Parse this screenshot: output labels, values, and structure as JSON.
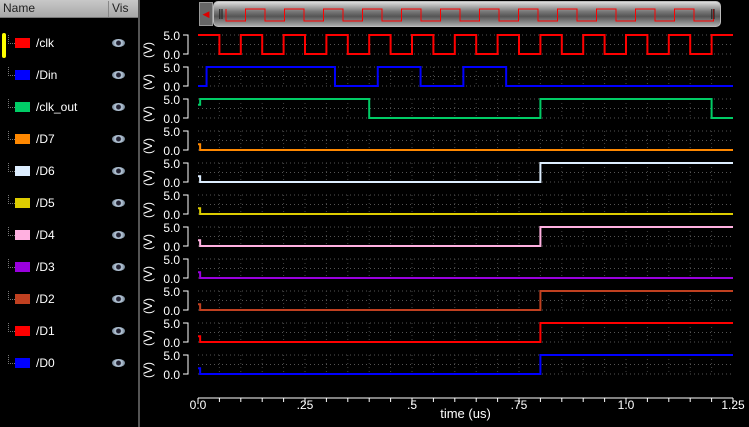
{
  "header": {
    "name_col": "Name",
    "vis_col": "Vis"
  },
  "signals": [
    {
      "name": "/clk",
      "color": "#ff0000"
    },
    {
      "name": "/Din",
      "color": "#0000ff"
    },
    {
      "name": "/clk_out",
      "color": "#00cc66"
    },
    {
      "name": "/D7",
      "color": "#ff8800"
    },
    {
      "name": "/D6",
      "color": "#ddeeff"
    },
    {
      "name": "/D5",
      "color": "#ddcc00"
    },
    {
      "name": "/D4",
      "color": "#ffb0e0"
    },
    {
      "name": "/D3",
      "color": "#9900dd"
    },
    {
      "name": "/D2",
      "color": "#c04020"
    },
    {
      "name": "/D1",
      "color": "#ff0000"
    },
    {
      "name": "/D0",
      "color": "#0000ff"
    }
  ],
  "chart_data": {
    "type": "line",
    "xlabel": "time (us)",
    "ylabel": "(V)",
    "xlim": [
      0,
      1.25
    ],
    "ylim": [
      0,
      5.0
    ],
    "ytick_labels": [
      "5.0",
      "0.0"
    ],
    "xtick_labels": [
      "0.0",
      ".25",
      ".5",
      ".75",
      "1.0",
      "1.25"
    ],
    "xtick_values": [
      0,
      0.25,
      0.5,
      0.75,
      1.0,
      1.25
    ],
    "series": [
      {
        "name": "/clk",
        "steps": [
          [
            0,
            5
          ],
          [
            0.05,
            0
          ],
          [
            0.1,
            5
          ],
          [
            0.15,
            0
          ],
          [
            0.2,
            5
          ],
          [
            0.25,
            0
          ],
          [
            0.3,
            5
          ],
          [
            0.35,
            0
          ],
          [
            0.4,
            5
          ],
          [
            0.45,
            0
          ],
          [
            0.5,
            5
          ],
          [
            0.55,
            0
          ],
          [
            0.6,
            5
          ],
          [
            0.65,
            0
          ],
          [
            0.7,
            5
          ],
          [
            0.75,
            0
          ],
          [
            0.8,
            5
          ],
          [
            0.85,
            0
          ],
          [
            0.9,
            5
          ],
          [
            0.95,
            0
          ],
          [
            1.0,
            5
          ],
          [
            1.05,
            0
          ],
          [
            1.1,
            5
          ],
          [
            1.15,
            0
          ],
          [
            1.2,
            5
          ]
        ]
      },
      {
        "name": "/Din",
        "steps": [
          [
            0,
            0
          ],
          [
            0.02,
            5
          ],
          [
            0.32,
            0
          ],
          [
            0.42,
            5
          ],
          [
            0.52,
            0
          ],
          [
            0.62,
            5
          ],
          [
            0.72,
            0
          ]
        ]
      },
      {
        "name": "/clk_out",
        "steps": [
          [
            0,
            3.5
          ],
          [
            0.005,
            5
          ],
          [
            0.4,
            0
          ],
          [
            0.8,
            5
          ],
          [
            1.2,
            0
          ]
        ]
      },
      {
        "name": "/D7",
        "steps": [
          [
            0,
            1.5
          ],
          [
            0.005,
            0
          ]
        ]
      },
      {
        "name": "/D6",
        "steps": [
          [
            0,
            1.5
          ],
          [
            0.005,
            0
          ],
          [
            0.8,
            5
          ]
        ]
      },
      {
        "name": "/D5",
        "steps": [
          [
            0,
            1.5
          ],
          [
            0.005,
            0
          ]
        ]
      },
      {
        "name": "/D4",
        "steps": [
          [
            0,
            1.5
          ],
          [
            0.005,
            0
          ],
          [
            0.8,
            5
          ]
        ]
      },
      {
        "name": "/D3",
        "steps": [
          [
            0,
            1.5
          ],
          [
            0.005,
            0
          ]
        ]
      },
      {
        "name": "/D2",
        "steps": [
          [
            0,
            1.5
          ],
          [
            0.005,
            0
          ],
          [
            0.8,
            5
          ]
        ]
      },
      {
        "name": "/D1",
        "steps": [
          [
            0,
            1.5
          ],
          [
            0.005,
            0
          ],
          [
            0.8,
            5
          ]
        ]
      },
      {
        "name": "/D0",
        "steps": [
          [
            0,
            1.5
          ],
          [
            0.005,
            0
          ],
          [
            0.8,
            5
          ]
        ]
      }
    ]
  }
}
